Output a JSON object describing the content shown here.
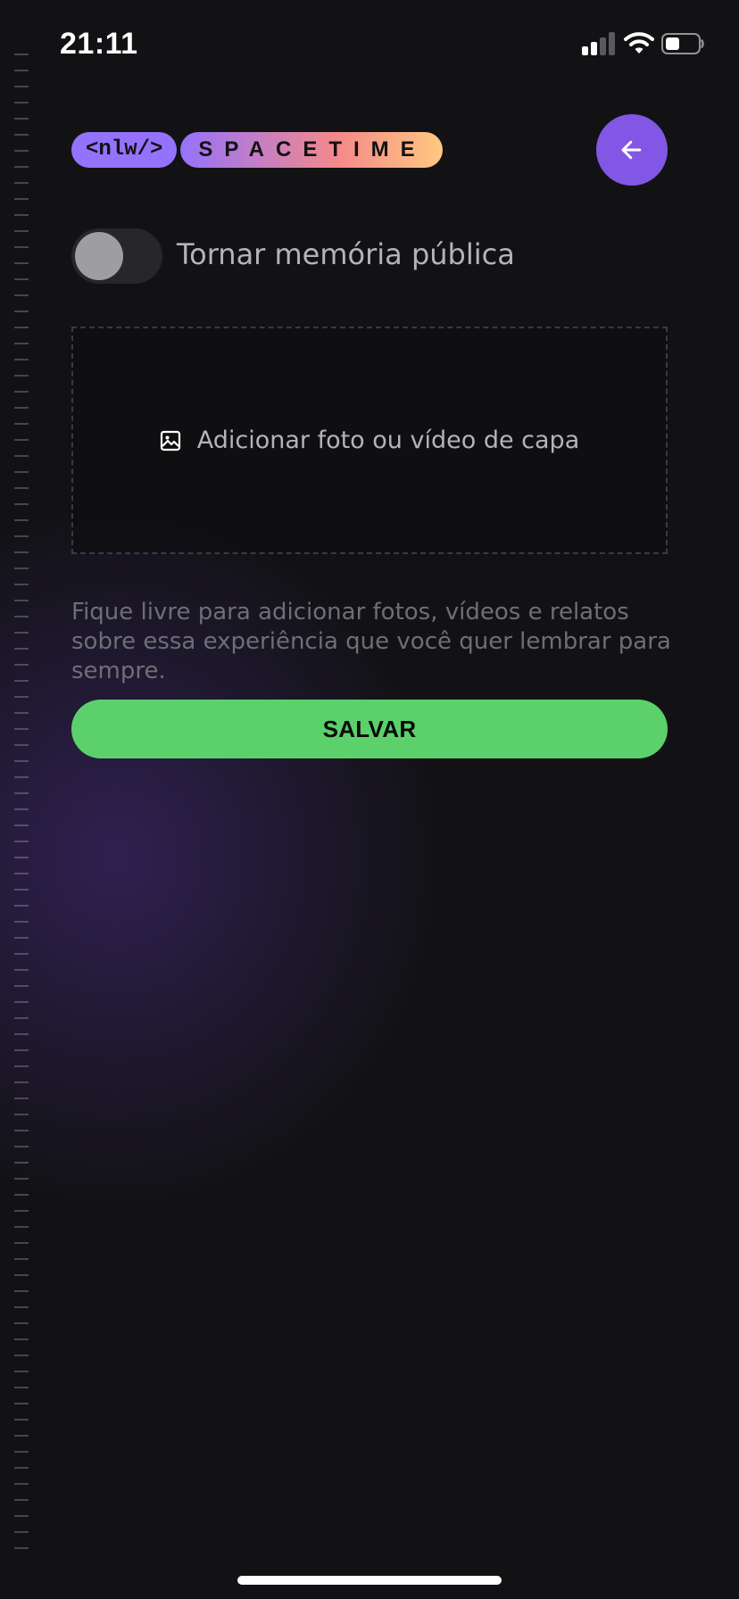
{
  "status_bar": {
    "time": "21:11",
    "signal_icon": "cellular-signal-icon",
    "wifi_icon": "wifi-icon",
    "battery_icon": "battery-icon",
    "signal_bars_active": 2,
    "signal_bars_total": 4,
    "battery_level": 0.35
  },
  "header": {
    "logo_nlw": "<nlw/>",
    "logo_brand": "SPACETIME",
    "back_icon": "arrow-left-icon"
  },
  "public_toggle": {
    "label": "Tornar memória pública",
    "checked": false
  },
  "media_picker": {
    "icon": "image-icon",
    "label": "Adicionar foto ou vídeo de capa"
  },
  "content": {
    "placeholder": "Fique livre para adicionar fotos, vídeos e relatos sobre essa experiência que você quer lembrar para sempre."
  },
  "actions": {
    "save_label": "SALVAR"
  },
  "colors": {
    "background": "#121215",
    "accent_purple": "#8257e5",
    "logo_purple": "#9572fc",
    "save_green": "#5cd16b",
    "toggle_track": "#26262b",
    "toggle_knob": "#9e9ea0",
    "muted_text": "#6e6e76"
  }
}
